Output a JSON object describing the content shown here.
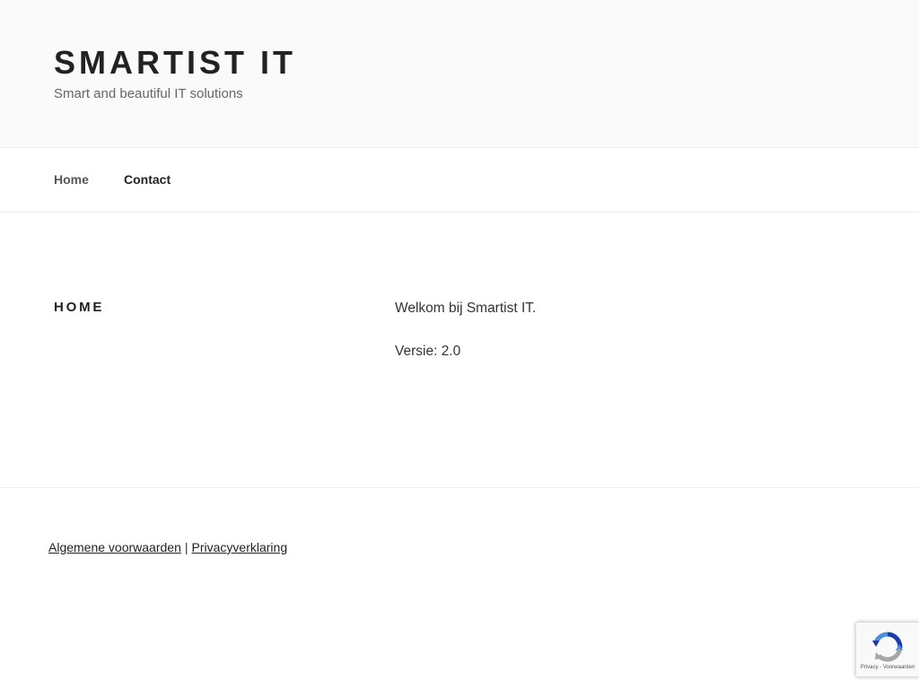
{
  "header": {
    "site_title": "SMARTIST IT",
    "tagline": "Smart and beautiful IT solutions"
  },
  "nav": {
    "items": [
      {
        "label": "Home"
      },
      {
        "label": "Contact"
      }
    ]
  },
  "main": {
    "page_title": "HOME",
    "paragraphs": [
      "Welkom bij Smartist IT.",
      "Versie: 2.0"
    ]
  },
  "footer": {
    "terms_link": "Algemene voorwaarden",
    "separator": "|",
    "privacy_link": "Privacyverklaring"
  },
  "recaptcha": {
    "icon": "recaptcha-logo",
    "privacy": "Privacy",
    "dash": " - ",
    "terms": "Voorwaarden"
  },
  "colors": {
    "header_bg": "#fafafa",
    "text": "#222222",
    "muted": "#666666"
  }
}
